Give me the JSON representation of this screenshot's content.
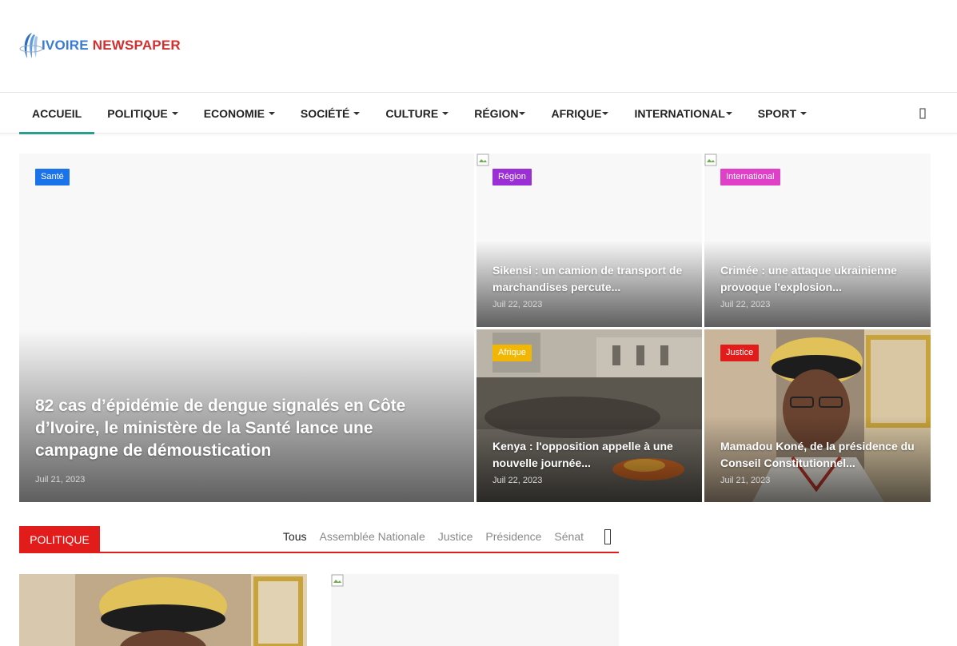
{
  "logo": {
    "text_a": "IVOIRE",
    "text_b": " NEWSPAPER",
    "color_a": "#3a7bd5",
    "color_b": "#d32f2f"
  },
  "nav": {
    "items": [
      {
        "label": "ACCUEIL",
        "active": true,
        "dropdown": false
      },
      {
        "label": "POLITIQUE",
        "dropdown": true
      },
      {
        "label": "ECONOMIE",
        "dropdown": true
      },
      {
        "label": "SOCIÉTÉ",
        "dropdown": true
      },
      {
        "label": "CULTURE",
        "dropdown": true
      },
      {
        "label": "RÉGION",
        "dropdown": true
      },
      {
        "label": "AFRIQUE",
        "dropdown": true
      },
      {
        "label": "INTERNATIONAL",
        "dropdown": true
      },
      {
        "label": "SPORT",
        "dropdown": true
      }
    ],
    "search_icon": "search-icon",
    "active_color": "#2a9d8f"
  },
  "featured": {
    "main": {
      "category": "Santé",
      "category_color": "#1a73e8",
      "title": "82 cas d’épidémie de dengue signalés en Côte d’Ivoire, le ministère de la Santé lance une campagne de démoustication",
      "date": "Juil 21, 2023"
    },
    "cards": [
      {
        "category": "Région",
        "category_color": "#9b2fd6",
        "title": "Sikensi : un camion de transport de marchandises percute...",
        "date": "Juil 22, 2023"
      },
      {
        "category": "International",
        "category_color": "#e040c8",
        "title": "Crimée : une attaque ukrainienne provoque l'explosion...",
        "date": "Juil 22, 2023"
      },
      {
        "category": "Afrique",
        "category_color": "#f2b705",
        "title": "Kenya : l'opposition appelle à une nouvelle journée...",
        "date": "Juil 22, 2023"
      },
      {
        "category": "Justice",
        "category_color": "#e21b1b",
        "title": "Mamadou Koné, de la présidence du Conseil Constitutionnel...",
        "date": "Juil 21, 2023"
      }
    ]
  },
  "politique": {
    "title": "POLITIQUE",
    "accent": "#e21b1b",
    "tabs": [
      {
        "label": "Tous",
        "active": true
      },
      {
        "label": "Assemblée Nationale"
      },
      {
        "label": "Justice"
      },
      {
        "label": "Présidence"
      },
      {
        "label": "Sénat"
      }
    ]
  }
}
